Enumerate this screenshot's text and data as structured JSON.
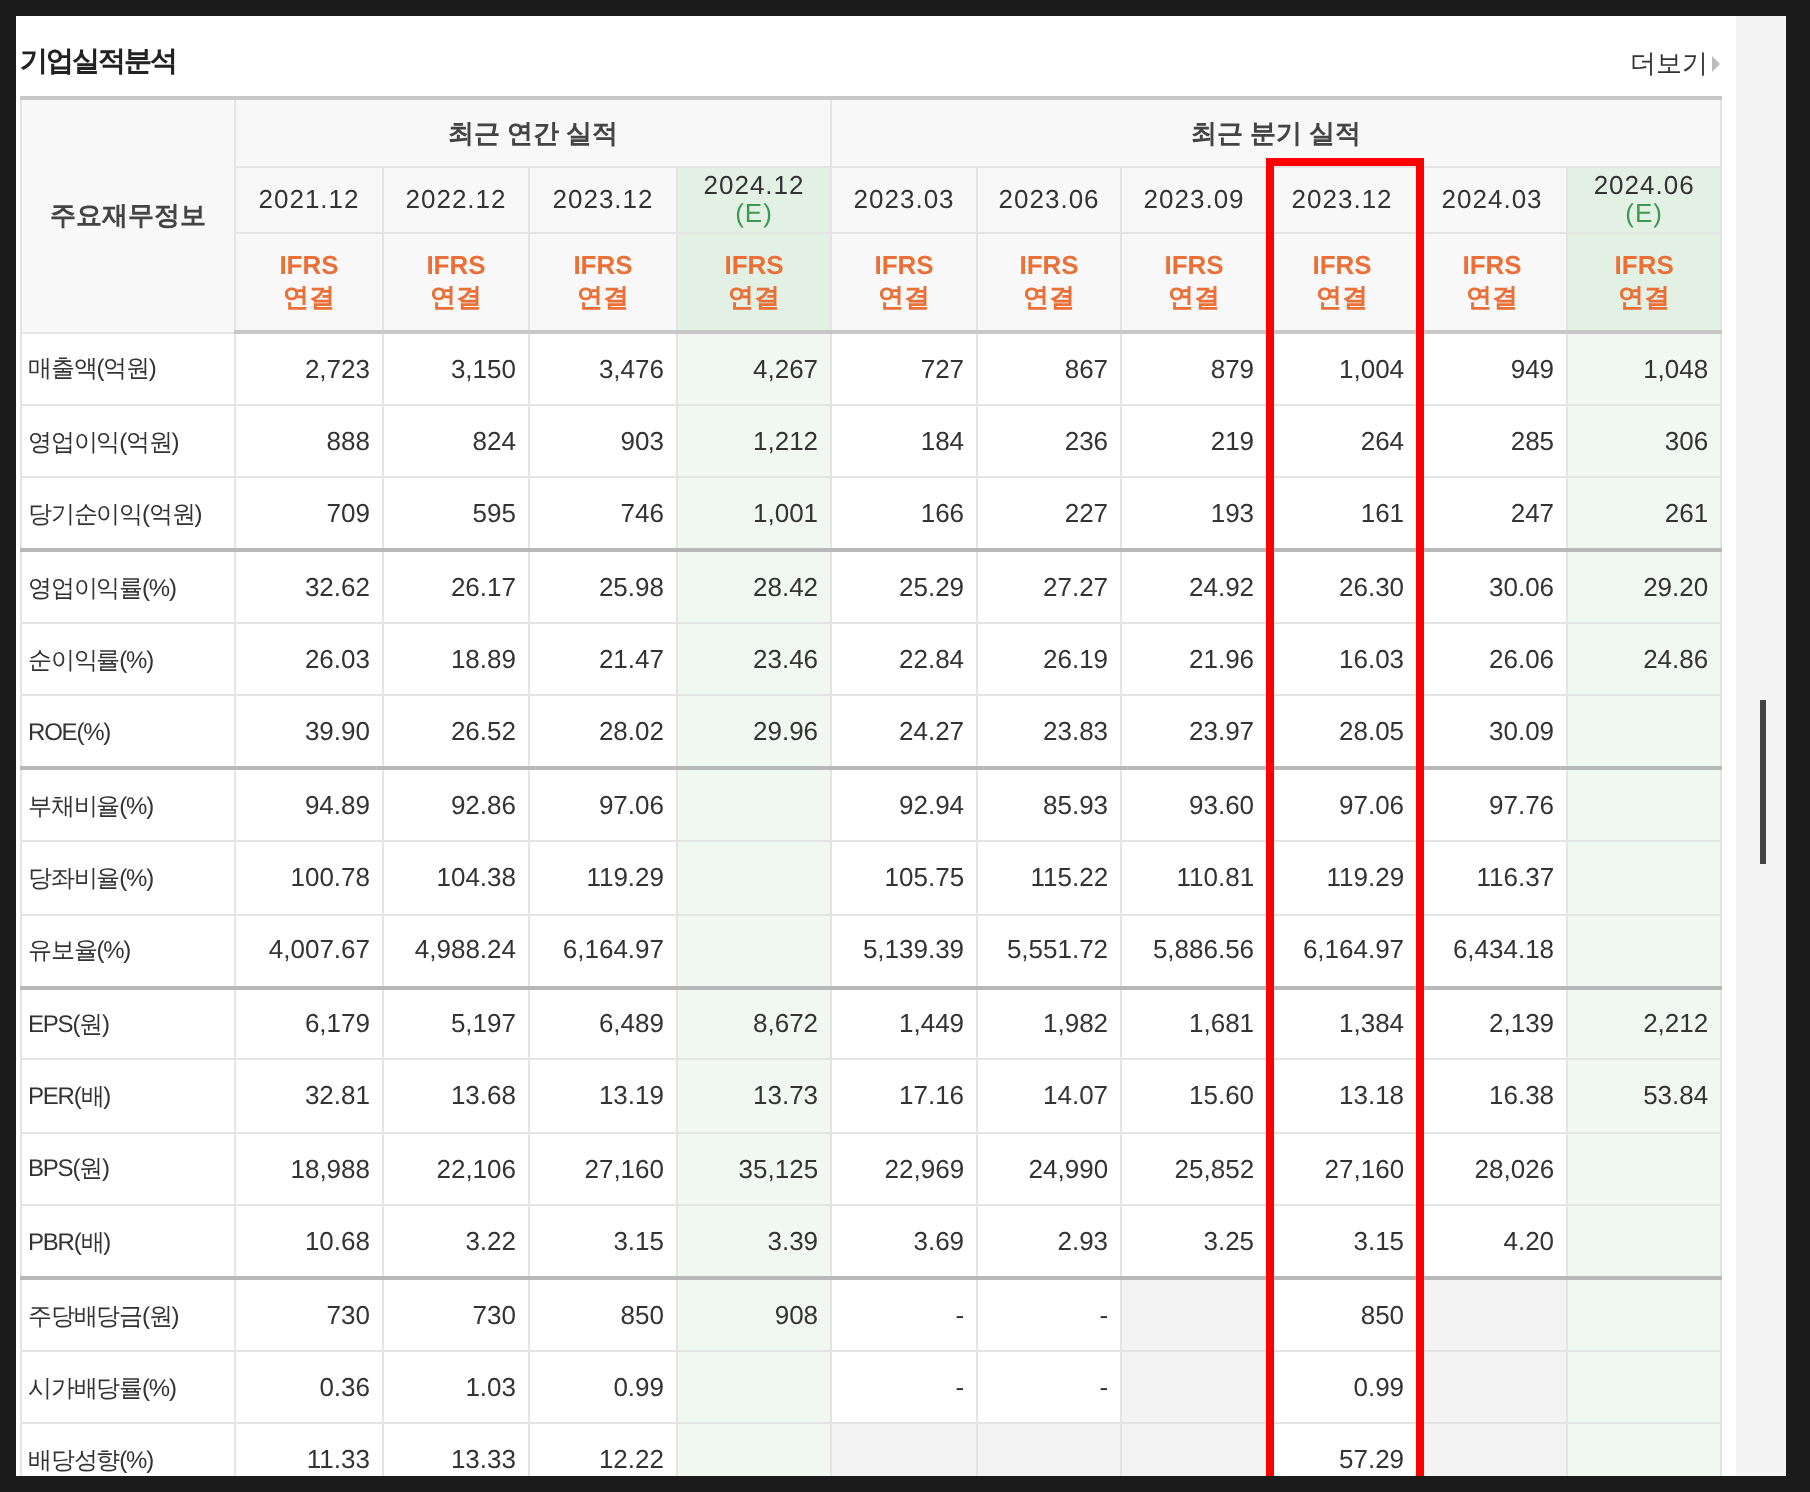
{
  "title": "기업실적분석",
  "more_link": "더보기",
  "header": {
    "label_column": "주요재무정보",
    "groups": [
      {
        "label": "최근 연간 실적",
        "columns": [
          {
            "period": "2021.12",
            "estimate": false,
            "standard": "IFRS",
            "basis": "연결",
            "highlighted": false
          },
          {
            "period": "2022.12",
            "estimate": false,
            "standard": "IFRS",
            "basis": "연결",
            "highlighted": false
          },
          {
            "period": "2023.12",
            "estimate": false,
            "standard": "IFRS",
            "basis": "연결",
            "highlighted": false
          },
          {
            "period": "2024.12",
            "note": "(E)",
            "estimate": true,
            "standard": "IFRS",
            "basis": "연결",
            "highlighted": false
          }
        ]
      },
      {
        "label": "최근 분기 실적",
        "columns": [
          {
            "period": "2023.03",
            "estimate": false,
            "standard": "IFRS",
            "basis": "연결",
            "highlighted": false
          },
          {
            "period": "2023.06",
            "estimate": false,
            "standard": "IFRS",
            "basis": "연결",
            "highlighted": false
          },
          {
            "period": "2023.09",
            "estimate": false,
            "standard": "IFRS",
            "basis": "연결",
            "highlighted": false
          },
          {
            "period": "2023.12",
            "estimate": false,
            "standard": "IFRS",
            "basis": "연결",
            "highlighted": true
          },
          {
            "period": "2024.03",
            "estimate": false,
            "standard": "IFRS",
            "basis": "연결",
            "highlighted": false
          },
          {
            "period": "2024.06",
            "note": "(E)",
            "estimate": true,
            "standard": "IFRS",
            "basis": "연결",
            "highlighted": false
          }
        ]
      }
    ]
  },
  "rows": [
    {
      "label": "매출액(억원)",
      "section_end": false,
      "cells": [
        {
          "value": "2,723"
        },
        {
          "value": "3,150"
        },
        {
          "value": "3,476"
        },
        {
          "value": "4,267"
        },
        {
          "value": "727"
        },
        {
          "value": "867"
        },
        {
          "value": "879"
        },
        {
          "value": "1,004"
        },
        {
          "value": "949"
        },
        {
          "value": "1,048"
        }
      ]
    },
    {
      "label": "영업이익(억원)",
      "section_end": false,
      "cells": [
        {
          "value": "888"
        },
        {
          "value": "824"
        },
        {
          "value": "903"
        },
        {
          "value": "1,212"
        },
        {
          "value": "184"
        },
        {
          "value": "236"
        },
        {
          "value": "219"
        },
        {
          "value": "264"
        },
        {
          "value": "285"
        },
        {
          "value": "306"
        }
      ]
    },
    {
      "label": "당기순이익(억원)",
      "section_end": true,
      "cells": [
        {
          "value": "709"
        },
        {
          "value": "595"
        },
        {
          "value": "746"
        },
        {
          "value": "1,001"
        },
        {
          "value": "166"
        },
        {
          "value": "227"
        },
        {
          "value": "193"
        },
        {
          "value": "161"
        },
        {
          "value": "247"
        },
        {
          "value": "261"
        }
      ]
    },
    {
      "label": "영업이익률(%)",
      "section_end": false,
      "cells": [
        {
          "value": "32.62"
        },
        {
          "value": "26.17"
        },
        {
          "value": "25.98"
        },
        {
          "value": "28.42"
        },
        {
          "value": "25.29"
        },
        {
          "value": "27.27"
        },
        {
          "value": "24.92"
        },
        {
          "value": "26.30"
        },
        {
          "value": "30.06"
        },
        {
          "value": "29.20"
        }
      ]
    },
    {
      "label": "순이익률(%)",
      "section_end": false,
      "cells": [
        {
          "value": "26.03"
        },
        {
          "value": "18.89"
        },
        {
          "value": "21.47"
        },
        {
          "value": "23.46"
        },
        {
          "value": "22.84"
        },
        {
          "value": "26.19"
        },
        {
          "value": "21.96"
        },
        {
          "value": "16.03"
        },
        {
          "value": "26.06"
        },
        {
          "value": "24.86"
        }
      ]
    },
    {
      "label": "ROE(%)",
      "section_end": true,
      "cells": [
        {
          "value": "39.90"
        },
        {
          "value": "26.52"
        },
        {
          "value": "28.02"
        },
        {
          "value": "29.96"
        },
        {
          "value": "24.27"
        },
        {
          "value": "23.83"
        },
        {
          "value": "23.97"
        },
        {
          "value": "28.05"
        },
        {
          "value": "30.09"
        },
        {
          "blank": true
        }
      ]
    },
    {
      "label": "부채비율(%)",
      "section_end": false,
      "cells": [
        {
          "value": "94.89"
        },
        {
          "value": "92.86"
        },
        {
          "value": "97.06"
        },
        {
          "blank": true
        },
        {
          "value": "92.94"
        },
        {
          "value": "85.93"
        },
        {
          "value": "93.60"
        },
        {
          "value": "97.06"
        },
        {
          "value": "97.76"
        },
        {
          "blank": true
        }
      ]
    },
    {
      "label": "당좌비율(%)",
      "section_end": false,
      "cells": [
        {
          "value": "100.78"
        },
        {
          "value": "104.38"
        },
        {
          "value": "119.29"
        },
        {
          "blank": true
        },
        {
          "value": "105.75"
        },
        {
          "value": "115.22"
        },
        {
          "value": "110.81"
        },
        {
          "value": "119.29"
        },
        {
          "value": "116.37"
        },
        {
          "blank": true
        }
      ]
    },
    {
      "label": "유보율(%)",
      "section_end": true,
      "cells": [
        {
          "value": "4,007.67"
        },
        {
          "value": "4,988.24"
        },
        {
          "value": "6,164.97"
        },
        {
          "blank": true
        },
        {
          "value": "5,139.39"
        },
        {
          "value": "5,551.72"
        },
        {
          "value": "5,886.56"
        },
        {
          "value": "6,164.97"
        },
        {
          "value": "6,434.18"
        },
        {
          "blank": true
        }
      ]
    },
    {
      "label": "EPS(원)",
      "section_end": false,
      "cells": [
        {
          "value": "6,179"
        },
        {
          "value": "5,197"
        },
        {
          "value": "6,489"
        },
        {
          "value": "8,672"
        },
        {
          "value": "1,449"
        },
        {
          "value": "1,982"
        },
        {
          "value": "1,681"
        },
        {
          "value": "1,384"
        },
        {
          "value": "2,139"
        },
        {
          "value": "2,212"
        }
      ]
    },
    {
      "label": "PER(배)",
      "section_end": false,
      "cells": [
        {
          "value": "32.81"
        },
        {
          "value": "13.68"
        },
        {
          "value": "13.19"
        },
        {
          "value": "13.73"
        },
        {
          "value": "17.16"
        },
        {
          "value": "14.07"
        },
        {
          "value": "15.60"
        },
        {
          "value": "13.18"
        },
        {
          "value": "16.38"
        },
        {
          "value": "53.84"
        }
      ]
    },
    {
      "label": "BPS(원)",
      "section_end": false,
      "cells": [
        {
          "value": "18,988"
        },
        {
          "value": "22,106"
        },
        {
          "value": "27,160"
        },
        {
          "value": "35,125"
        },
        {
          "value": "22,969"
        },
        {
          "value": "24,990"
        },
        {
          "value": "25,852"
        },
        {
          "value": "27,160"
        },
        {
          "value": "28,026"
        },
        {
          "blank": true
        }
      ]
    },
    {
      "label": "PBR(배)",
      "section_end": true,
      "cells": [
        {
          "value": "10.68"
        },
        {
          "value": "3.22"
        },
        {
          "value": "3.15"
        },
        {
          "value": "3.39"
        },
        {
          "value": "3.69"
        },
        {
          "value": "2.93"
        },
        {
          "value": "3.25"
        },
        {
          "value": "3.15"
        },
        {
          "value": "4.20"
        },
        {
          "blank": true
        }
      ]
    },
    {
      "label": "주당배당금(원)",
      "section_end": false,
      "cells": [
        {
          "value": "730"
        },
        {
          "value": "730"
        },
        {
          "value": "850"
        },
        {
          "value": "908"
        },
        {
          "value": "-"
        },
        {
          "value": "-"
        },
        {
          "blank": true
        },
        {
          "value": "850"
        },
        {
          "blank": true
        },
        {
          "blank": true
        }
      ]
    },
    {
      "label": "시가배당률(%)",
      "section_end": false,
      "cells": [
        {
          "value": "0.36"
        },
        {
          "value": "1.03"
        },
        {
          "value": "0.99"
        },
        {
          "blank": true
        },
        {
          "value": "-"
        },
        {
          "value": "-"
        },
        {
          "blank": true
        },
        {
          "value": "0.99"
        },
        {
          "blank": true
        },
        {
          "blank": true
        }
      ]
    },
    {
      "label": "배당성향(%)",
      "section_end": false,
      "cells": [
        {
          "value": "11.33"
        },
        {
          "value": "13.33"
        },
        {
          "value": "12.22"
        },
        {
          "blank": true
        },
        {
          "blank": true
        },
        {
          "blank": true
        },
        {
          "blank": true
        },
        {
          "value": "57.29"
        },
        {
          "blank": true
        },
        {
          "blank": true
        }
      ]
    }
  ]
}
